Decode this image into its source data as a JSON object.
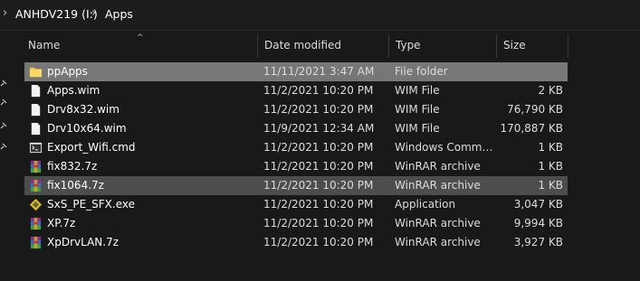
{
  "breadcrumb": {
    "drive": "ANHDV219 (I:)",
    "folder": "Apps"
  },
  "columns": {
    "name": "Name",
    "date_modified": "Date modified",
    "type": "Type",
    "size": "Size"
  },
  "files": [
    {
      "name": "ppApps",
      "date": "11/11/2021 3:47 AM",
      "type": "File folder",
      "size": "",
      "icon": "folder-icon",
      "state": "selected"
    },
    {
      "name": "Apps.wim",
      "date": "11/2/2021 10:20 PM",
      "type": "WIM File",
      "size": "2 KB",
      "icon": "file-icon",
      "state": ""
    },
    {
      "name": "Drv8x32.wim",
      "date": "11/2/2021 10:20 PM",
      "type": "WIM File",
      "size": "76,790 KB",
      "icon": "file-icon",
      "state": ""
    },
    {
      "name": "Drv10x64.wim",
      "date": "11/9/2021 12:34 AM",
      "type": "WIM File",
      "size": "170,887 KB",
      "icon": "file-icon",
      "state": ""
    },
    {
      "name": "Export_Wifi.cmd",
      "date": "11/2/2021 10:20 PM",
      "type": "Windows Comma...",
      "size": "1 KB",
      "icon": "cmd-icon",
      "state": ""
    },
    {
      "name": "fix832.7z",
      "date": "11/2/2021 10:20 PM",
      "type": "WinRAR archive",
      "size": "1 KB",
      "icon": "winrar-icon",
      "state": ""
    },
    {
      "name": "fix1064.7z",
      "date": "11/2/2021 10:20 PM",
      "type": "WinRAR archive",
      "size": "1 KB",
      "icon": "winrar-icon",
      "state": "hover"
    },
    {
      "name": "SxS_PE_SFX.exe",
      "date": "11/2/2021 10:20 PM",
      "type": "Application",
      "size": "3,047 KB",
      "icon": "exe-icon",
      "state": ""
    },
    {
      "name": "XP.7z",
      "date": "11/2/2021 10:20 PM",
      "type": "WinRAR archive",
      "size": "9,994 KB",
      "icon": "winrar-icon",
      "state": ""
    },
    {
      "name": "XpDrvLAN.7z",
      "date": "11/2/2021 10:20 PM",
      "type": "WinRAR archive",
      "size": "3,927 KB",
      "icon": "winrar-icon",
      "state": ""
    }
  ],
  "colors": {
    "background": "#191919",
    "selected_row": "#777777",
    "hover_row": "#4d4d4d",
    "folder": "#f3c744"
  }
}
